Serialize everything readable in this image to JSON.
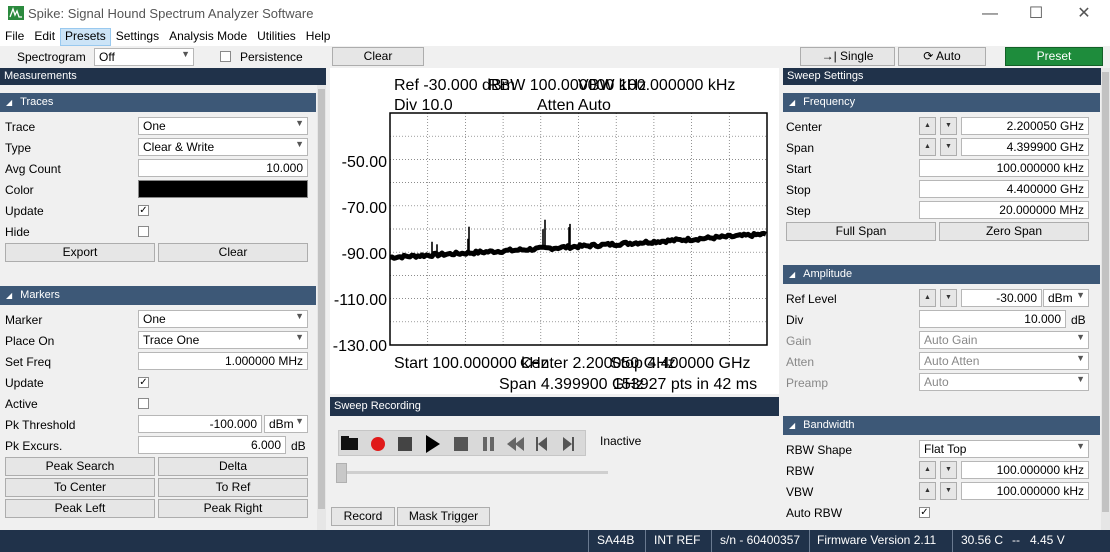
{
  "window": {
    "title": "Spike: Signal Hound Spectrum Analyzer Software"
  },
  "menu": [
    "File",
    "Edit",
    "Presets",
    "Settings",
    "Analysis Mode",
    "Utilities",
    "Help"
  ],
  "toolbar": {
    "spectrogram_label": "Spectrogram",
    "spectrogram_value": "Off",
    "persistence_label": "Persistence",
    "clear_label": "Clear",
    "single_label": "Single",
    "auto_label": "Auto",
    "preset_label": "Preset"
  },
  "left": {
    "header": "Measurements",
    "traces": {
      "title": "Traces",
      "trace_label": "Trace",
      "trace_value": "One",
      "type_label": "Type",
      "type_value": "Clear & Write",
      "avg_label": "Avg Count",
      "avg_value": "10.000",
      "color_label": "Color",
      "update_label": "Update",
      "hide_label": "Hide",
      "export_label": "Export",
      "clear_label": "Clear"
    },
    "markers": {
      "title": "Markers",
      "marker_label": "Marker",
      "marker_value": "One",
      "placeon_label": "Place On",
      "placeon_value": "Trace One",
      "setfreq_label": "Set Freq",
      "setfreq_value": "1.000000 MHz",
      "update_label": "Update",
      "active_label": "Active",
      "pkthr_label": "Pk Threshold",
      "pkthr_value": "-100.000",
      "pkthr_unit": "dBm",
      "pkexc_label": "Pk Excurs.",
      "pkexc_value": "6.000",
      "pkexc_unit": "dB",
      "peaksearch": "Peak Search",
      "delta": "Delta",
      "tocenter": "To Center",
      "toref": "To Ref",
      "peakleft": "Peak Left",
      "peakright": "Peak Right"
    }
  },
  "plot": {
    "line1a": "Ref -30.000 dBm",
    "line1b": "RBW 100.000000 kHz",
    "line1c": "VBW 100.000000 kHz",
    "line2a": "Div 10.0",
    "line2b": "Atten Auto",
    "yticks": [
      "-50.00",
      "-70.00",
      "-90.00",
      "-110.00",
      "-130.00"
    ],
    "foot1a": "Start 100.000000 kHz",
    "foot1b": "Center 2.200050 GHz",
    "foot1c": "Stop 4.400000 GHz",
    "foot2a": "Span 4.399900 GHz",
    "foot2b": "153927 pts in 42 ms",
    "trace_color": "#000000"
  },
  "recording": {
    "title": "Sweep Recording",
    "status": "Inactive",
    "record_tab": "Record",
    "mask_tab": "Mask Trigger"
  },
  "right": {
    "header": "Sweep Settings",
    "freq": {
      "title": "Frequency",
      "center_label": "Center",
      "center_value": "2.200050 GHz",
      "span_label": "Span",
      "span_value": "4.399900 GHz",
      "start_label": "Start",
      "start_value": "100.000000 kHz",
      "stop_label": "Stop",
      "stop_value": "4.400000 GHz",
      "step_label": "Step",
      "step_value": "20.000000 MHz",
      "fullspan": "Full Span",
      "zerospan": "Zero Span"
    },
    "amp": {
      "title": "Amplitude",
      "ref_label": "Ref Level",
      "ref_value": "-30.000",
      "ref_unit": "dBm",
      "div_label": "Div",
      "div_value": "10.000",
      "div_unit": "dB",
      "gain_label": "Gain",
      "gain_value": "Auto Gain",
      "atten_label": "Atten",
      "atten_value": "Auto Atten",
      "preamp_label": "Preamp",
      "preamp_value": "Auto"
    },
    "bw": {
      "title": "Bandwidth",
      "shape_label": "RBW Shape",
      "shape_value": "Flat Top",
      "rbw_label": "RBW",
      "rbw_value": "100.000000 kHz",
      "vbw_label": "VBW",
      "vbw_value": "100.000000 kHz",
      "autorbw_label": "Auto RBW"
    }
  },
  "status": {
    "device": "SA44B",
    "ref": "INT REF",
    "serial": "s/n - 60400357",
    "firmware": "Firmware Version 2.11",
    "temp": "30.56 C",
    "volt": "4.45 V",
    "temp_volt_sep": "--"
  },
  "colors": {
    "panel_header": "#20324a",
    "group_header": "#3d5877",
    "preset_button": "#1e8c3c"
  }
}
